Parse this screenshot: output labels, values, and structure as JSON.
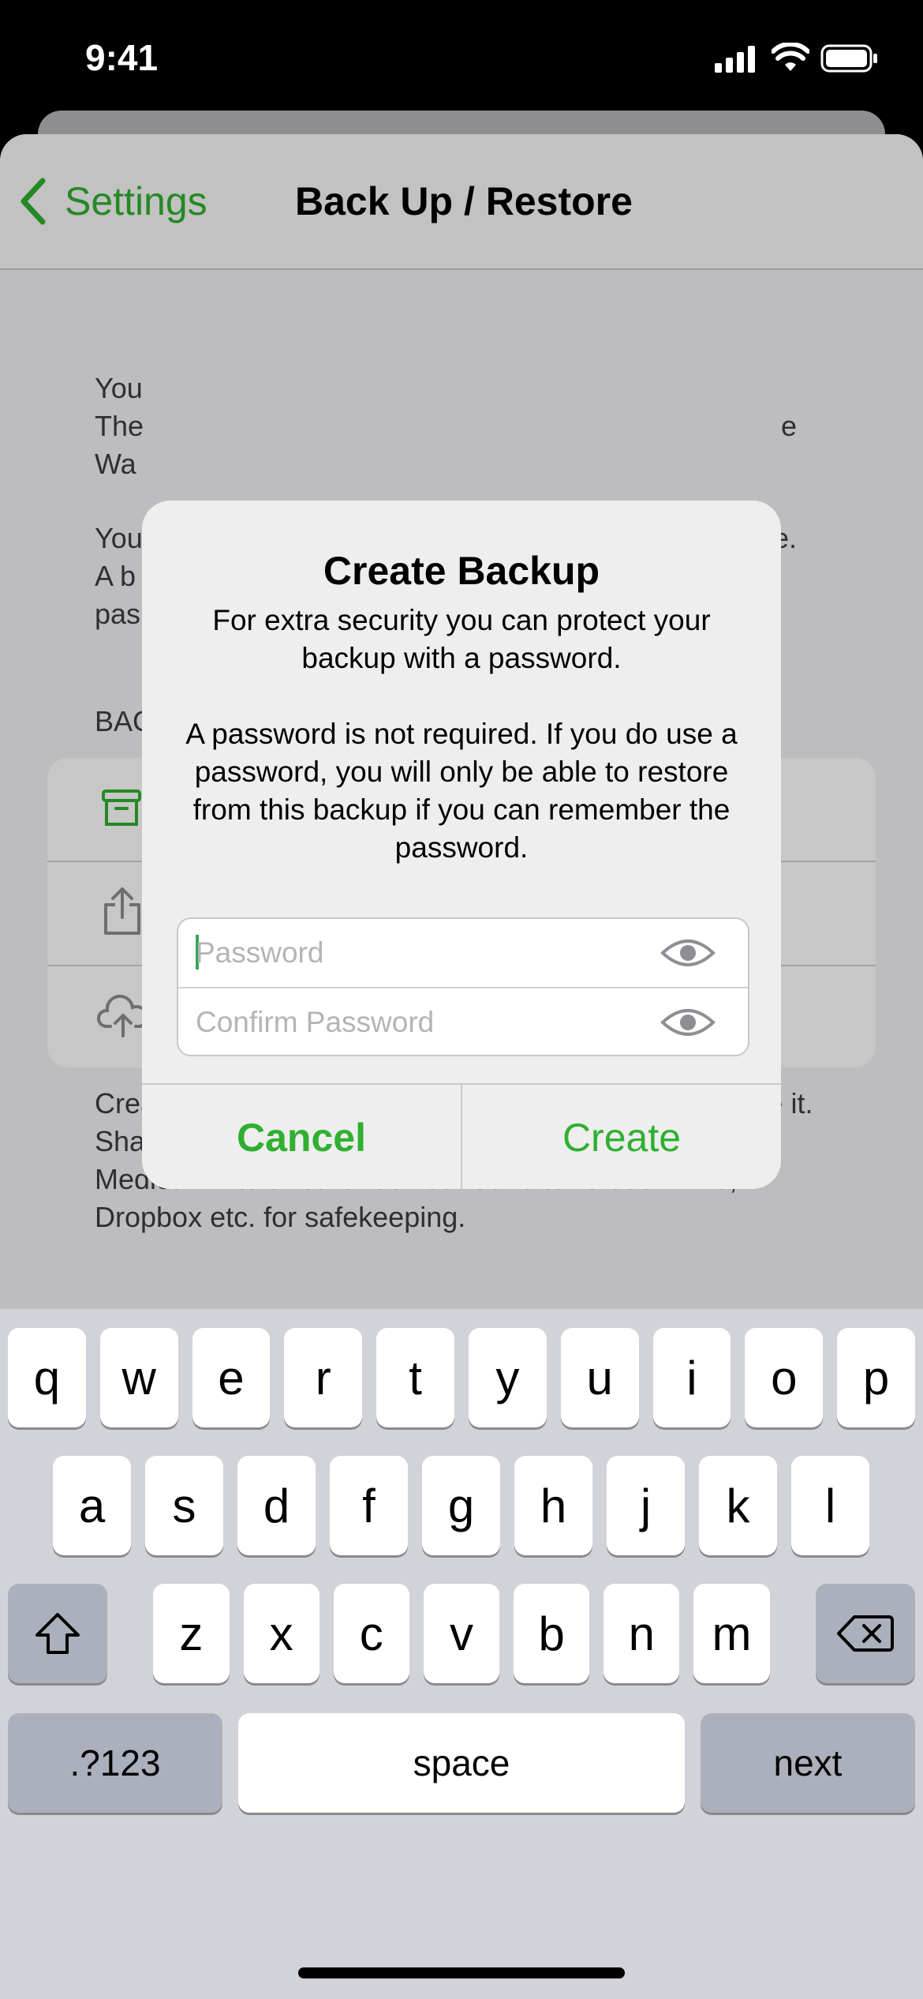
{
  "status_bar": {
    "time": "9:41"
  },
  "nav": {
    "back_label": "Settings",
    "title": "Back Up / Restore"
  },
  "background": {
    "paragraph1_lines": [
      "You",
      "The",
      "Wa"
    ],
    "paragraph1_tail_lines": [
      "e"
    ],
    "paragraph2_lines": [
      "You",
      "A b",
      "pas"
    ],
    "paragraph2_tail": "e.",
    "section_header": "BAC",
    "footer": "Create a backup of your Medical ID then share or save it. Sharing with AirDrop is the simplest way to copy your Medical ID to another device. Save to iCloud Drive, Dropbox etc. for safekeeping."
  },
  "alert": {
    "title": "Create Backup",
    "message_line1": "For extra security you can protect your backup with a password.",
    "message_line2": "A password is not required. If you do use a password, you will only be able to restore from this backup if you can remember the password.",
    "password_placeholder": "Password",
    "confirm_placeholder": "Confirm Password",
    "cancel_label": "Cancel",
    "create_label": "Create"
  },
  "keyboard": {
    "row1": [
      "q",
      "w",
      "e",
      "r",
      "t",
      "y",
      "u",
      "i",
      "o",
      "p"
    ],
    "row2": [
      "a",
      "s",
      "d",
      "f",
      "g",
      "h",
      "j",
      "k",
      "l"
    ],
    "row3": [
      "z",
      "x",
      "c",
      "v",
      "b",
      "n",
      "m"
    ],
    "numbers_label": ".?123",
    "space_label": "space",
    "next_label": "next"
  },
  "colors": {
    "accent": "#2fb02f"
  }
}
